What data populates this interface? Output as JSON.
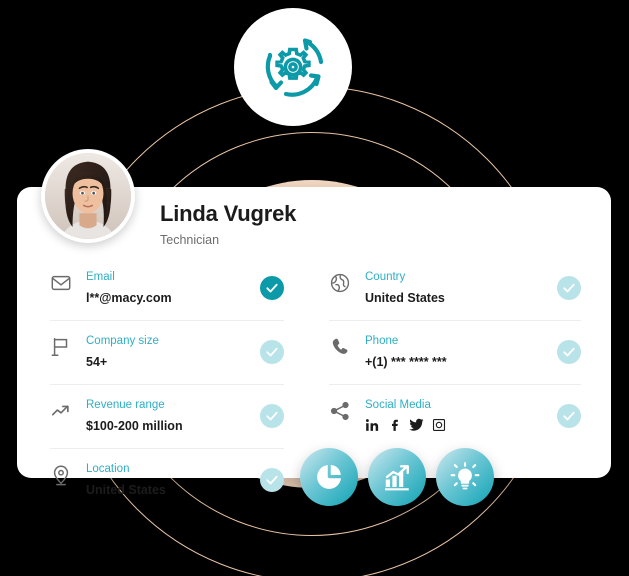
{
  "background": {
    "canvas_color": "#000000",
    "ring_color": "#e8c4a4",
    "disc_color": "#fadfc7"
  },
  "badge": {
    "name": "process-automation-badge",
    "icon": "gear-rotating-arrows-icon",
    "icon_color": "#0d9aa8",
    "circle_color": "#ffffff"
  },
  "card": {
    "background": "#ffffff",
    "profile": {
      "avatar_alt": "Linda Vugrek profile photo",
      "name": "Linda Vugrek",
      "role": "Technician"
    },
    "accent_label_color": "#2eafc4",
    "check_active_color": "#0d9aa8",
    "check_inactive_color": "#b8e3e8",
    "left_fields": [
      {
        "icon": "envelope-icon",
        "label": "Email",
        "value": "l**@macy.com",
        "verified": true,
        "verified_state": "active"
      },
      {
        "icon": "flag-icon",
        "label": "Company size",
        "value": "54+",
        "verified": true,
        "verified_state": "inactive"
      },
      {
        "icon": "trending-up-icon",
        "label": "Revenue range",
        "value": "$100-200 million",
        "verified": true,
        "verified_state": "inactive"
      },
      {
        "icon": "location-pin-icon",
        "label": "Location",
        "value": "United States",
        "verified": true,
        "verified_state": "inactive"
      }
    ],
    "right_fields": [
      {
        "icon": "globe-icon",
        "label": "Country",
        "value": "United States",
        "verified": true,
        "verified_state": "inactive"
      },
      {
        "icon": "phone-icon",
        "label": "Phone",
        "value": "+(1) *** **** ***",
        "verified": true,
        "verified_state": "inactive"
      },
      {
        "icon": "share-nodes-icon",
        "label": "Social Media",
        "value": "",
        "social_links": [
          {
            "name": "linkedin-icon",
            "glyph": "in"
          },
          {
            "name": "facebook-icon",
            "glyph": "f"
          },
          {
            "name": "twitter-icon",
            "glyph": "bird"
          },
          {
            "name": "instagram-icon",
            "glyph": "camera"
          }
        ],
        "verified": true,
        "verified_state": "inactive"
      }
    ]
  },
  "feature_icons": [
    {
      "name": "pie-chart-icon",
      "label": "Pie chart analytics"
    },
    {
      "name": "bar-chart-growth-icon",
      "label": "Growth analytics"
    },
    {
      "name": "lightbulb-icon",
      "label": "Insights"
    }
  ]
}
